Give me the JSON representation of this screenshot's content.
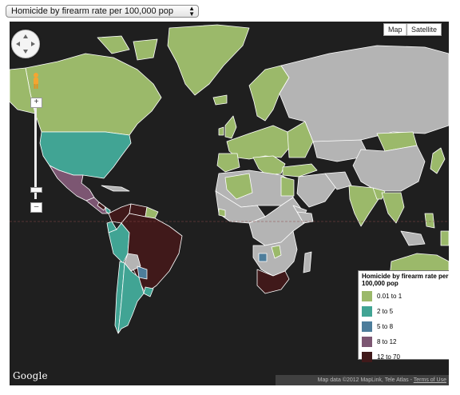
{
  "selector": {
    "label": "Homicide by firearm rate per 100,000 pop"
  },
  "map_type": {
    "map_label": "Map",
    "satellite_label": "Satellite"
  },
  "zoom": {
    "in_label": "+",
    "out_label": "–"
  },
  "logo": "Google",
  "attribution": {
    "text": "Map data ©2012 MapLink, Tele Atlas - ",
    "terms": "Terms of Use"
  },
  "legend": {
    "title": "Homicide by firearm rate per 100,000 pop",
    "items": [
      {
        "label": "0.01 to 1",
        "color": "#9bb96a"
      },
      {
        "label": "2 to 5",
        "color": "#41a494"
      },
      {
        "label": "5 to 8",
        "color": "#4d7d9b"
      },
      {
        "label": "8 to 12",
        "color": "#7c5672"
      },
      {
        "label": "12 to 70",
        "color": "#40191a"
      }
    ]
  },
  "colors": {
    "ocean": "#1f1f1f",
    "no_data": "#b4b4b4",
    "border": "#ffffff"
  }
}
